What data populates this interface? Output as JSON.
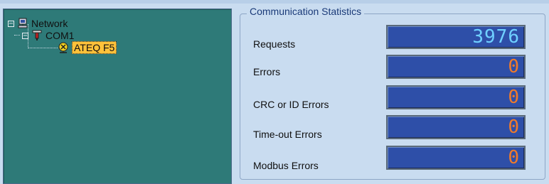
{
  "tree": {
    "network_label": "Network",
    "com_label": "COM1",
    "device_label": "ATEQ F5",
    "expander_symbol": "−"
  },
  "stats": {
    "title": "Communication Statistics",
    "rows": [
      {
        "label": "Requests",
        "value": "3976"
      },
      {
        "label": "Errors",
        "value": "0"
      },
      {
        "label": "CRC or ID Errors",
        "value": "0"
      },
      {
        "label": "Time-out Errors",
        "value": "0"
      },
      {
        "label": "Modbus Errors",
        "value": "0"
      }
    ]
  },
  "colors": {
    "panel_bg": "#2e7a78",
    "counter_bg": "#2e4fa8",
    "counter_main_digits": "#6fd0ff",
    "counter_error_digits": "#f07a2a",
    "selected_highlight": "#ffc23a",
    "page_bg": "#c9dcf0"
  },
  "icons": {
    "network": "computer-network-icon",
    "com": "serial-port-icon",
    "device": "device-node-icon"
  }
}
